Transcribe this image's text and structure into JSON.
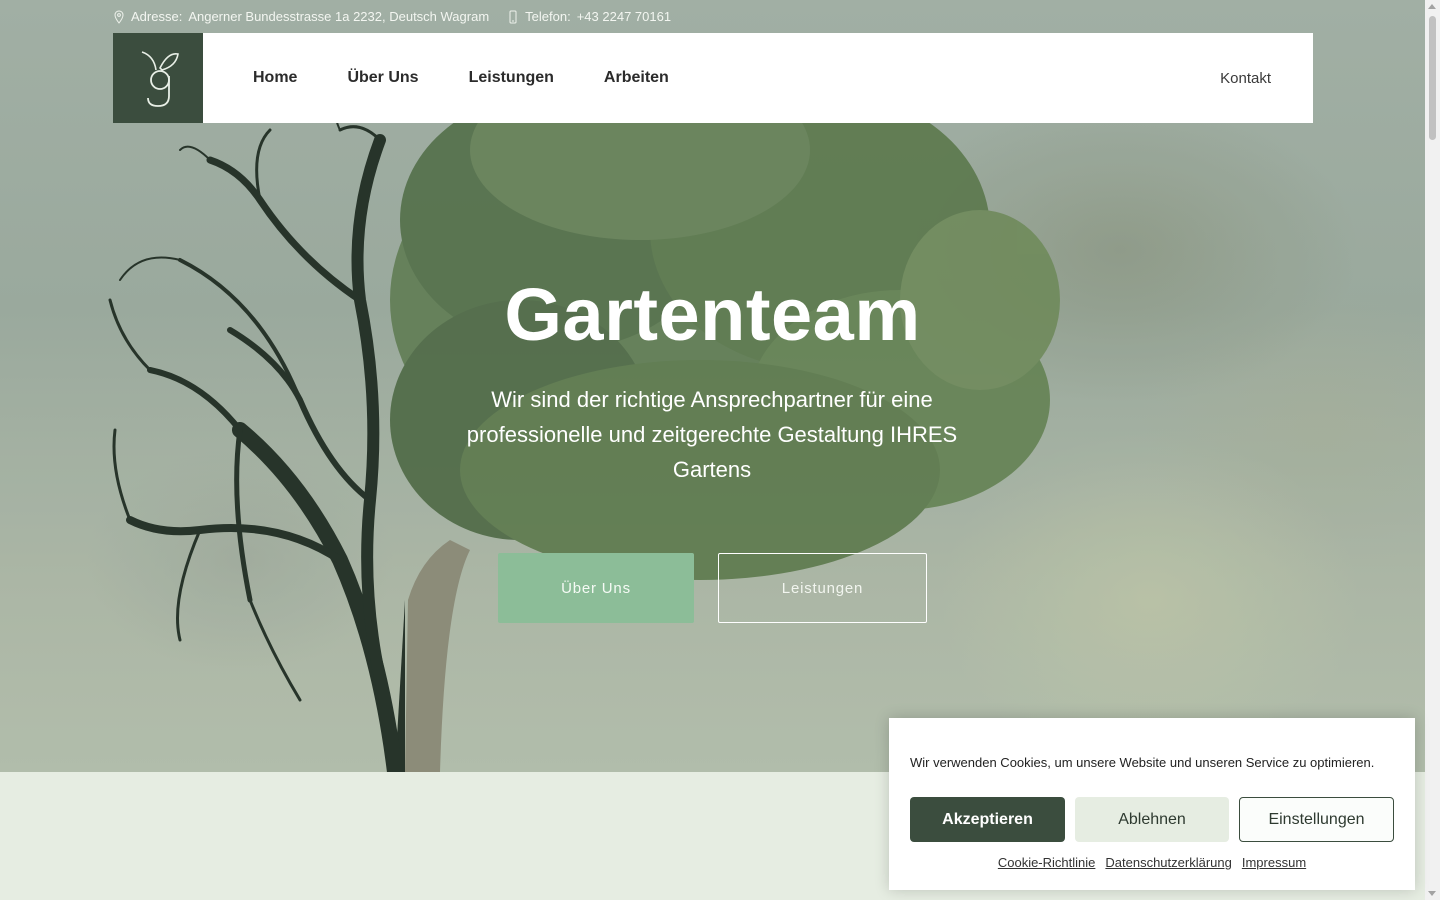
{
  "topbar": {
    "address_label": "Adresse:",
    "address_value": "Angerner Bundesstrasse 1a 2232, Deutsch Wagram",
    "phone_label": "Telefon:",
    "phone_value": "+43 2247 70161"
  },
  "nav": {
    "items": [
      "Home",
      "Über Uns",
      "Leistungen",
      "Arbeiten"
    ],
    "kontakt": "Kontakt"
  },
  "hero": {
    "title": "Gartenteam",
    "subtitle": "Wir sind der richtige Ansprechpartner für eine professionelle und zeitgerechte Gestaltung IHRES Gartens",
    "btn_primary": "Über Uns",
    "btn_secondary": "Leistungen"
  },
  "cookie": {
    "text": "Wir verwenden Cookies, um unsere Website und unseren Service zu optimieren.",
    "accept": "Akzeptieren",
    "deny": "Ablehnen",
    "settings": "Einstellungen",
    "links": [
      "Cookie-Richtlinie",
      "Datenschutzerklärung",
      "Impressum"
    ]
  },
  "colors": {
    "brand_dark": "#3b4d3e",
    "accent_green": "#8cbd98",
    "light_green": "#e6ede2"
  },
  "icons": {
    "address": "map-pin-icon",
    "phone": "phone-icon",
    "logo": "leaf-g-logo"
  }
}
